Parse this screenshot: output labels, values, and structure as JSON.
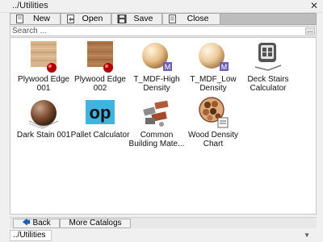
{
  "window": {
    "title": "../Utilities"
  },
  "toolbar": {
    "new_label": "New",
    "open_label": "Open",
    "save_label": "Save",
    "close_label": "Close"
  },
  "search": {
    "placeholder": "Search ...",
    "more_label": "..."
  },
  "items": [
    {
      "label": "Plywood Edge 001",
      "icon": "plywood-edge-icon"
    },
    {
      "label": "Plywood Edge 002",
      "icon": "plywood-edge-icon"
    },
    {
      "label": "T_MDF-High Density",
      "icon": "mdf-sphere-icon"
    },
    {
      "label": "T_MDF_Low Density",
      "icon": "mdf-sphere-icon"
    },
    {
      "label": "Deck Stairs Calculator",
      "icon": "stairs-calculator-icon"
    },
    {
      "label": "Dark Stain 001",
      "icon": "dark-stain-sphere-icon"
    },
    {
      "label": "Pallet Calculator",
      "icon": "op-icon"
    },
    {
      "label": "Common Building Mate...",
      "icon": "bricks-icon"
    },
    {
      "label": "Wood Density Chart",
      "icon": "wood-density-chart-icon"
    }
  ],
  "bottom": {
    "back_label": "Back",
    "more_catalogs_label": "More Catalogs"
  },
  "path": {
    "current": "../Utilities"
  },
  "colors": {
    "toolbar_bg": "#bdbdbd",
    "panel_bg": "#ffffff",
    "window_bg": "#f0f0f0"
  }
}
